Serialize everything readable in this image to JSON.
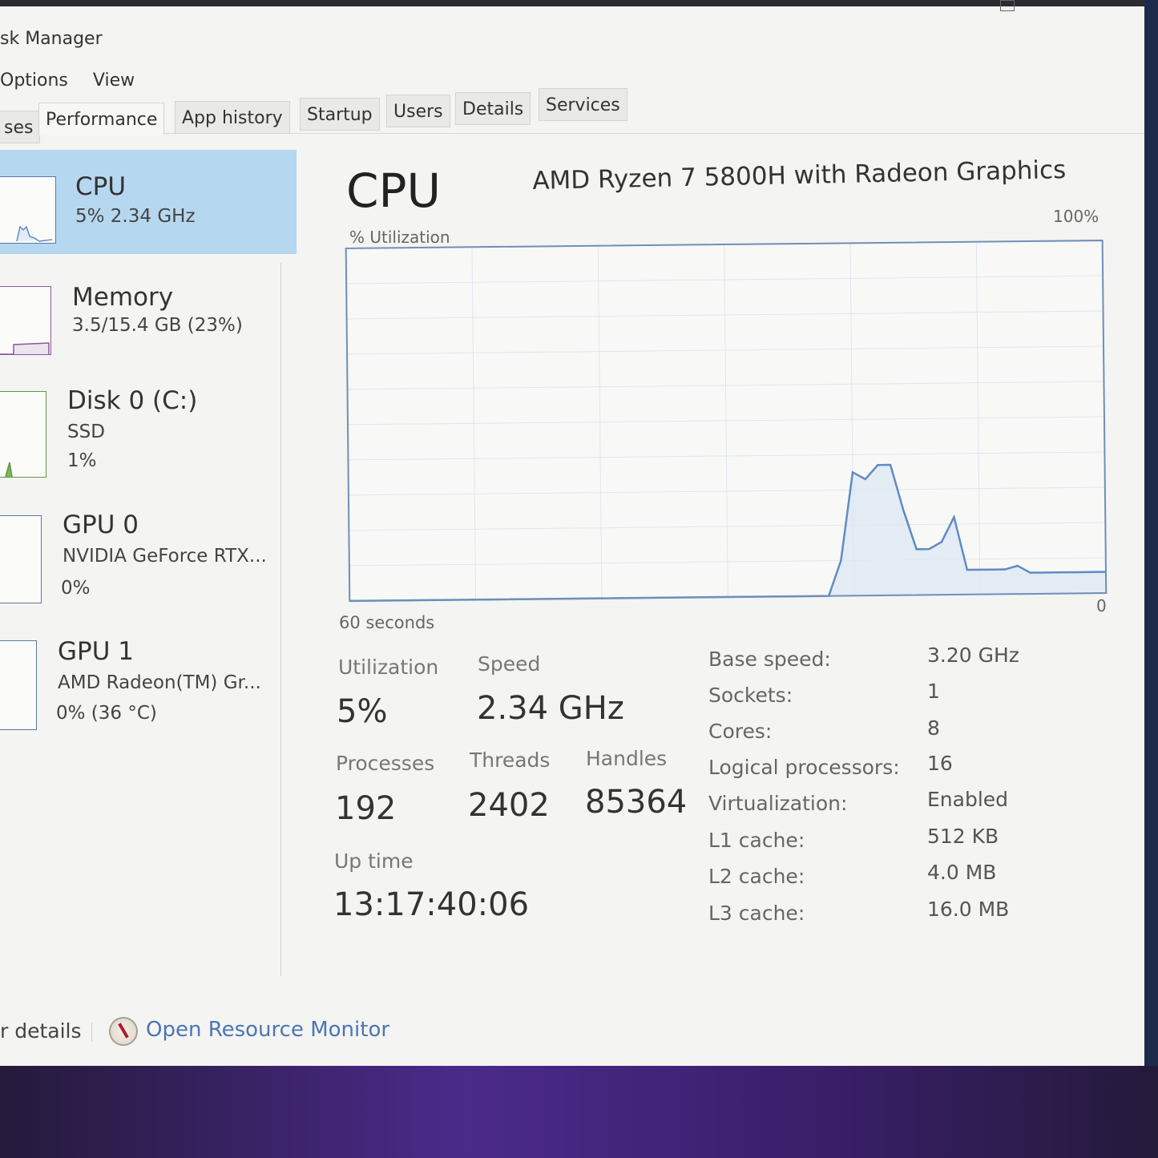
{
  "window": {
    "title": "sk Manager",
    "menu": [
      "Options",
      "View"
    ]
  },
  "tabs": [
    {
      "label": "ses",
      "active": false
    },
    {
      "label": "Performance",
      "active": true
    },
    {
      "label": "App history",
      "active": false
    },
    {
      "label": "Startup",
      "active": false
    },
    {
      "label": "Users",
      "active": false
    },
    {
      "label": "Details",
      "active": false
    },
    {
      "label": "Services",
      "active": false
    }
  ],
  "sidebar": {
    "items": [
      {
        "name": "CPU",
        "sub1": "5% 2.34 GHz",
        "sub2": "",
        "selected": true
      },
      {
        "name": "Memory",
        "sub1": "3.5/15.4 GB (23%)",
        "sub2": "",
        "selected": false
      },
      {
        "name": "Disk 0 (C:)",
        "sub1": "SSD",
        "sub2": "1%",
        "selected": false
      },
      {
        "name": "GPU 0",
        "sub1": "NVIDIA GeForce RTX...",
        "sub2": "0%",
        "selected": false
      },
      {
        "name": "GPU 1",
        "sub1": "AMD Radeon(TM) Gr...",
        "sub2": "0% (36 °C)",
        "selected": false
      }
    ]
  },
  "main": {
    "title": "CPU",
    "model": "AMD Ryzen 7 5800H with Radeon Graphics",
    "stats": {
      "utilization_label": "Utilization",
      "utilization_value": "5%",
      "speed_label": "Speed",
      "speed_value": "2.34 GHz",
      "processes_label": "Processes",
      "processes_value": "192",
      "threads_label": "Threads",
      "threads_value": "2402",
      "handles_label": "Handles",
      "handles_value": "85364",
      "uptime_label": "Up time",
      "uptime_value": "13:17:40:06"
    },
    "specs": [
      {
        "label": "Base speed:",
        "value": "3.20 GHz"
      },
      {
        "label": "Sockets:",
        "value": "1"
      },
      {
        "label": "Cores:",
        "value": "8"
      },
      {
        "label": "Logical processors:",
        "value": "16"
      },
      {
        "label": "Virtualization:",
        "value": "Enabled"
      },
      {
        "label": "L1 cache:",
        "value": "512 KB"
      },
      {
        "label": "L2 cache:",
        "value": "4.0 MB"
      },
      {
        "label": "L3 cache:",
        "value": "16.0 MB"
      }
    ]
  },
  "footer": {
    "details_label": "r details",
    "resource_monitor_label": "Open Resource Monitor"
  },
  "colors": {
    "accent_selected": "#b6d7f0",
    "chart_line": "#5f8bc4",
    "chart_fill": "#dde8f2",
    "link": "#4a76b5"
  },
  "chart_data": {
    "type": "area",
    "title": "% Utilization",
    "ylabel": "% Utilization",
    "xlabel": "60 seconds",
    "ymax_label": "100%",
    "ymin_label": "0",
    "ylim": [
      0,
      100
    ],
    "xlim": [
      0,
      60
    ],
    "grid": true,
    "x": [
      0,
      38,
      39,
      40,
      41,
      42,
      43,
      44,
      45,
      46,
      47,
      48,
      49,
      50,
      51,
      52,
      53,
      54,
      55,
      56,
      57,
      58,
      59,
      60
    ],
    "values": [
      0,
      0,
      10,
      35,
      33,
      37,
      37,
      24,
      13,
      13,
      15,
      22,
      7,
      7,
      7,
      7,
      8,
      6,
      6,
      6,
      6,
      6,
      6,
      6
    ]
  }
}
